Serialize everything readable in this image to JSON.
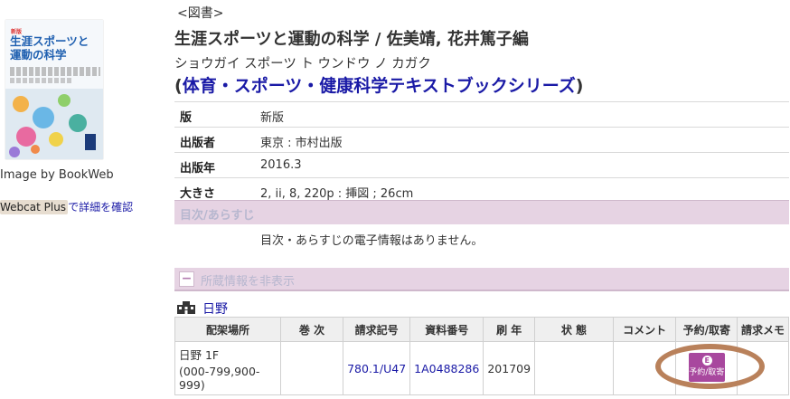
{
  "left": {
    "cover": {
      "edition_text": "新版",
      "title_line1": "生涯スポーツと",
      "title_line2": "運動の科学"
    },
    "image_credit": "Image by BookWeb",
    "webcat": {
      "button_label": "Webcat Plus",
      "link_text": "で詳細を確認"
    }
  },
  "record": {
    "material_type": "<図書>",
    "title": "生涯スポーツと運動の科学 / 佐美靖, 花井篤子編",
    "kana": "ショウガイ スポーツ ト ウンドウ ノ カガク",
    "series_open": "(",
    "series_link": "体育・スポーツ・健康科学テキストブックシリーズ",
    "series_close": ")",
    "details": [
      {
        "label": "版",
        "value": "新版"
      },
      {
        "label": "出版者",
        "value": "東京 : 市村出版"
      },
      {
        "label": "出版年",
        "value": "2016.3"
      },
      {
        "label": "大きさ",
        "value": "2, ii, 8, 220p : 挿図 ; 26cm"
      }
    ],
    "toc_heading": "目次/あらすじ",
    "toc_text": "目次・あらすじの電子情報はありません。"
  },
  "holdings": {
    "toggle_icon": "minus-icon",
    "toggle_label": "所蔵情報を非表示",
    "library_icon": "building-icon",
    "library_name": "日野",
    "columns": [
      "配架場所",
      "巻 次",
      "請求記号",
      "資料番号",
      "刷 年",
      "状 態",
      "コメント",
      "予約/取寄",
      "請求メモ"
    ],
    "rows": [
      {
        "location_line1": "日野 1F",
        "location_line2": "(000-799,900-999)",
        "volume": "",
        "call_number": "780.1/U47",
        "item_number": "1A0488286",
        "print_year": "201709",
        "status": "",
        "comment": "",
        "reserve_icon_glyph": "E",
        "reserve_label": "予約/取寄",
        "memo": ""
      }
    ]
  },
  "colors": {
    "link": "#1a1aa6",
    "section_bar": "#e6d3e3",
    "reserve_button": "#a8489e",
    "annotation_ring": "#b9815b"
  }
}
